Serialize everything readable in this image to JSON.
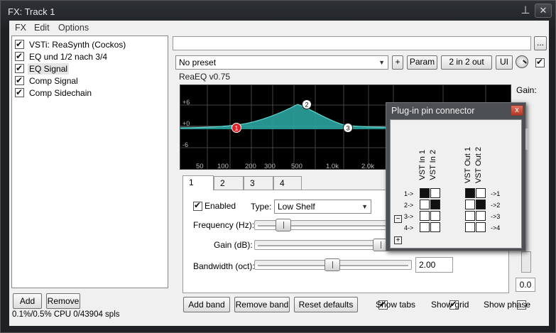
{
  "window": {
    "title": "FX: Track 1",
    "pin_glyph": "⊥",
    "close_glyph": "✕"
  },
  "menu": [
    "FX",
    "Edit",
    "Options"
  ],
  "fx_chain": {
    "items": [
      {
        "label": "VSTi: ReaSynth (Cockos)",
        "enabled": true,
        "selected": false
      },
      {
        "label": "EQ und 1/2 nach 3/4",
        "enabled": true,
        "selected": false
      },
      {
        "label": "EQ Signal",
        "enabled": true,
        "selected": true
      },
      {
        "label": "Comp Signal",
        "enabled": true,
        "selected": false
      },
      {
        "label": "Comp Sidechain",
        "enabled": true,
        "selected": false
      }
    ],
    "add_label": "Add",
    "remove_label": "Remove",
    "cpu_status": "0.1%/0.5% CPU 0/43904 spls"
  },
  "toolbar": {
    "more_label": "...",
    "preset_value": "No preset",
    "plus_label": "+",
    "param_label": "Param",
    "routing_label": "2 in 2 out",
    "ui_label": "UI"
  },
  "plugin": {
    "title": "ReaEQ v0.75",
    "gain_label": "Gain:",
    "gain_value": "0.0"
  },
  "graph": {
    "db_labels": [
      "+6",
      "+0",
      "-6"
    ],
    "freq_labels": [
      "50",
      "100",
      "200",
      "300",
      "500",
      "1.0k",
      "2.0k"
    ],
    "nodes": [
      {
        "label": "1",
        "color": "#e0202a"
      },
      {
        "label": "2",
        "color": "#ffffff"
      },
      {
        "label": "3",
        "color": "#ffffff"
      }
    ],
    "curve_color": "#2aa39f"
  },
  "tabs": [
    "1",
    "2",
    "3",
    "4"
  ],
  "band": {
    "enabled_label": "Enabled",
    "enabled": true,
    "type_label": "Type:",
    "type_value": "Low Shelf",
    "frequency_label": "Frequency (Hz):",
    "gain_label": "Gain (dB):",
    "bandwidth_label": "Bandwidth (oct):",
    "bandwidth_value": "2.00"
  },
  "footer": {
    "add_band": "Add band",
    "remove_band": "Remove band",
    "reset_defaults": "Reset defaults",
    "show_tabs": "Show tabs",
    "show_tabs_on": true,
    "show_grid": "Show grid",
    "show_grid_on": true,
    "show_phase": "Show phase",
    "show_phase_on": false
  },
  "pin_connector": {
    "title": "Plug-in pin connector",
    "close_glyph": "x",
    "inputs": [
      "VST In 1",
      "VST In 2"
    ],
    "outputs": [
      "VST Out 1",
      "VST Out 2"
    ],
    "in_rows": [
      "1->",
      "2->",
      "3->",
      "4->"
    ],
    "out_rows": [
      "->1",
      "->2",
      "->3",
      "->4"
    ],
    "in_matrix": [
      [
        true,
        false
      ],
      [
        false,
        true
      ],
      [
        false,
        false
      ],
      [
        false,
        false
      ]
    ],
    "out_matrix": [
      [
        true,
        false
      ],
      [
        false,
        true
      ],
      [
        false,
        false
      ],
      [
        false,
        false
      ]
    ],
    "minus_glyph": "−",
    "plus_glyph": "+"
  }
}
